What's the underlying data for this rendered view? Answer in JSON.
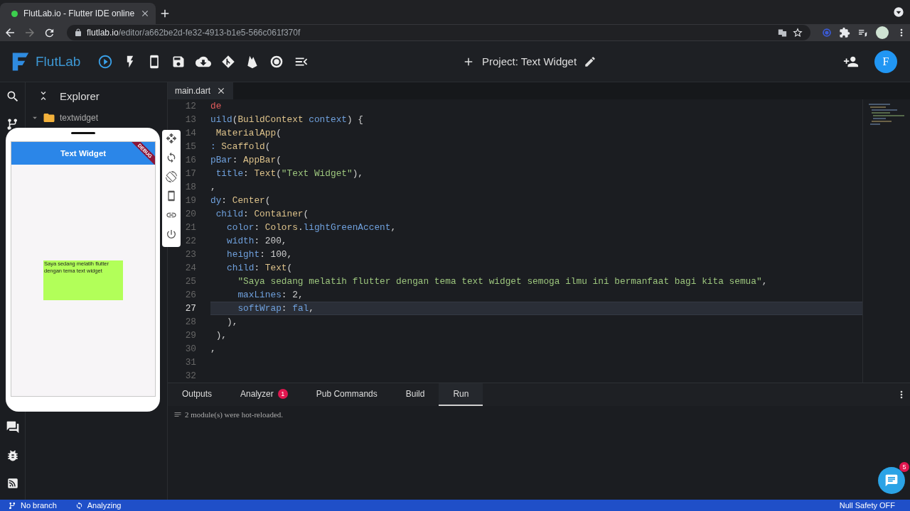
{
  "browser": {
    "tab_title": "FlutLab.io - Flutter IDE online",
    "url_host": "flutlab.io",
    "url_path": "/editor/a662be2d-fe32-4913-b1e5-566c061f370f"
  },
  "app_header": {
    "logo_text": "FlutLab",
    "project_title": "Project: Text Widget",
    "avatar_letter": "F"
  },
  "explorer": {
    "title": "Explorer",
    "tree": [
      {
        "label": "textwidget",
        "expanded": true
      }
    ]
  },
  "preview": {
    "app_bar_title": "Text Widget",
    "debug_banner": "DEBUG",
    "box_text": "Saya sedang melatih flutter dengan tema text widget"
  },
  "editor": {
    "tabs": [
      {
        "label": "main.dart",
        "selected": true
      }
    ],
    "lines": [
      {
        "number": "12",
        "current": false,
        "tokens": [
          {
            "text": "de",
            "kind": "err"
          }
        ]
      },
      {
        "number": "13",
        "current": false,
        "tokens": [
          {
            "text": "uild",
            "kind": "prop"
          },
          {
            "text": "(",
            "kind": "plain"
          },
          {
            "text": "BuildContext",
            "kind": "cls"
          },
          {
            "text": " context",
            "kind": "prop"
          },
          {
            "text": ") {",
            "kind": "plain"
          }
        ]
      },
      {
        "number": "14",
        "current": false,
        "tokens": [
          {
            "text": " MaterialApp",
            "kind": "cls"
          },
          {
            "text": "(",
            "kind": "plain"
          }
        ]
      },
      {
        "number": "15",
        "current": false,
        "tokens": [
          {
            "text": ":",
            "kind": "prop"
          },
          {
            "text": " Scaffold",
            "kind": "cls"
          },
          {
            "text": "(",
            "kind": "plain"
          }
        ]
      },
      {
        "number": "16",
        "current": false,
        "tokens": [
          {
            "text": "pBar",
            "kind": "prop"
          },
          {
            "text": ": ",
            "kind": "plain"
          },
          {
            "text": "AppBar",
            "kind": "cls"
          },
          {
            "text": "(",
            "kind": "plain"
          }
        ]
      },
      {
        "number": "17",
        "current": false,
        "tokens": [
          {
            "text": " title",
            "kind": "prop"
          },
          {
            "text": ": ",
            "kind": "plain"
          },
          {
            "text": "Text",
            "kind": "cls"
          },
          {
            "text": "(",
            "kind": "plain"
          },
          {
            "text": "\"Text Widget\"",
            "kind": "str"
          },
          {
            "text": "),",
            "kind": "plain"
          }
        ]
      },
      {
        "number": "18",
        "current": false,
        "tokens": [
          {
            "text": ",",
            "kind": "plain"
          }
        ]
      },
      {
        "number": "19",
        "current": false,
        "tokens": [
          {
            "text": "dy",
            "kind": "prop"
          },
          {
            "text": ": ",
            "kind": "plain"
          },
          {
            "text": "Center",
            "kind": "cls"
          },
          {
            "text": "(",
            "kind": "plain"
          }
        ]
      },
      {
        "number": "20",
        "current": false,
        "tokens": [
          {
            "text": " child",
            "kind": "prop"
          },
          {
            "text": ": ",
            "kind": "plain"
          },
          {
            "text": "Container",
            "kind": "cls"
          },
          {
            "text": "(",
            "kind": "plain"
          }
        ]
      },
      {
        "number": "21",
        "current": false,
        "tokens": [
          {
            "text": "   color",
            "kind": "prop"
          },
          {
            "text": ": ",
            "kind": "plain"
          },
          {
            "text": "Colors",
            "kind": "cls"
          },
          {
            "text": ".",
            "kind": "plain"
          },
          {
            "text": "lightGreenAccent",
            "kind": "prop"
          },
          {
            "text": ",",
            "kind": "plain"
          }
        ]
      },
      {
        "number": "22",
        "current": false,
        "tokens": [
          {
            "text": "   width",
            "kind": "prop"
          },
          {
            "text": ": 200,",
            "kind": "plain"
          }
        ]
      },
      {
        "number": "23",
        "current": false,
        "tokens": [
          {
            "text": "   height",
            "kind": "prop"
          },
          {
            "text": ": 100,",
            "kind": "plain"
          }
        ]
      },
      {
        "number": "24",
        "current": false,
        "tokens": [
          {
            "text": "   child",
            "kind": "prop"
          },
          {
            "text": ": ",
            "kind": "plain"
          },
          {
            "text": "Text",
            "kind": "cls"
          },
          {
            "text": "(",
            "kind": "plain"
          }
        ]
      },
      {
        "number": "25",
        "current": false,
        "tokens": [
          {
            "text": "     \"Saya sedang melatih flutter dengan tema text widget semoga ilmu ini bermanfaat bagi kita semua\"",
            "kind": "str"
          },
          {
            "text": ",",
            "kind": "plain"
          }
        ]
      },
      {
        "number": "26",
        "current": false,
        "tokens": [
          {
            "text": "     maxLines",
            "kind": "prop"
          },
          {
            "text": ": 2,",
            "kind": "plain"
          }
        ]
      },
      {
        "number": "27",
        "current": true,
        "tokens": [
          {
            "text": "     softWrap",
            "kind": "prop"
          },
          {
            "text": ": ",
            "kind": "plain"
          },
          {
            "text": "fal",
            "kind": "prop"
          },
          {
            "text": ",",
            "kind": "plain"
          }
        ]
      },
      {
        "number": "28",
        "current": false,
        "tokens": [
          {
            "text": "   ),",
            "kind": "plain"
          }
        ]
      },
      {
        "number": "29",
        "current": false,
        "tokens": [
          {
            "text": " ),",
            "kind": "plain"
          }
        ]
      },
      {
        "number": "30",
        "current": false,
        "tokens": [
          {
            "text": ",",
            "kind": "plain"
          }
        ]
      },
      {
        "number": "31",
        "current": false
      },
      {
        "number": "32",
        "current": false
      }
    ]
  },
  "bottom_panel": {
    "tabs": [
      {
        "label": "Outputs",
        "selected": false
      },
      {
        "label": "Analyzer",
        "selected": false,
        "badge": "1"
      },
      {
        "label": "Pub Commands",
        "selected": false
      },
      {
        "label": "Build",
        "selected": false
      },
      {
        "label": "Run",
        "selected": true
      }
    ],
    "output_lines": [
      "2 module(s) were hot-reloaded."
    ]
  },
  "chat": {
    "badge": "5"
  },
  "status_bar": {
    "branch": "No branch",
    "activity": "Analyzing",
    "null_safety": "Null Safety OFF"
  }
}
